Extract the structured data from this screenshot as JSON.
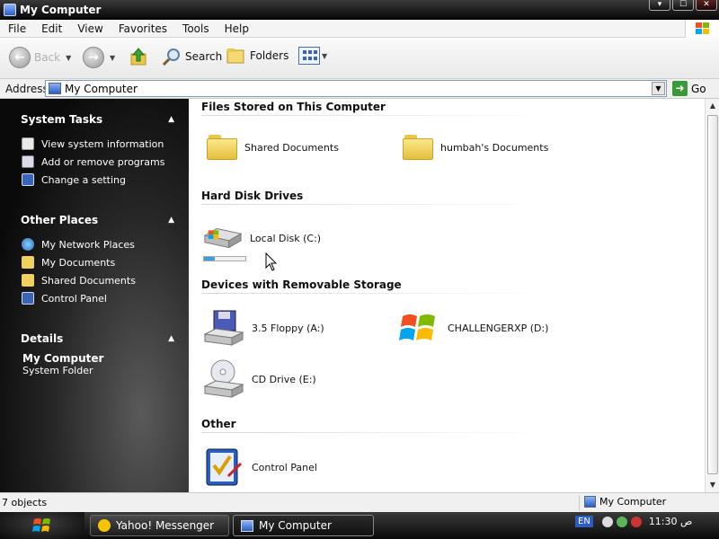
{
  "window": {
    "title": "My Computer",
    "controls": [
      "▾",
      "☐",
      "✕"
    ]
  },
  "menu": [
    "File",
    "Edit",
    "View",
    "Favorites",
    "Tools",
    "Help"
  ],
  "toolbar": {
    "back": "Back",
    "search": "Search",
    "folders": "Folders"
  },
  "address": {
    "label": "Address",
    "value": "My Computer",
    "go": "Go"
  },
  "sidebar": {
    "system_tasks": {
      "title": "System Tasks",
      "items": [
        {
          "label": "View system information",
          "icon": "system-info-icon"
        },
        {
          "label": "Add or remove programs",
          "icon": "add-remove-icon"
        },
        {
          "label": "Change a setting",
          "icon": "control-panel-icon"
        }
      ]
    },
    "other_places": {
      "title": "Other Places",
      "items": [
        {
          "label": "My Network Places",
          "icon": "network-icon"
        },
        {
          "label": "My Documents",
          "icon": "folder-icon"
        },
        {
          "label": "Shared Documents",
          "icon": "folder-icon"
        },
        {
          "label": "Control Panel",
          "icon": "control-panel-icon"
        }
      ]
    },
    "details": {
      "title": "Details",
      "name": "My Computer",
      "type": "System Folder"
    }
  },
  "content": {
    "groups": {
      "files": "Files Stored on This Computer",
      "hdd": "Hard Disk Drives",
      "removable": "Devices with Removable Storage",
      "other": "Other"
    },
    "items": {
      "shared_docs": "Shared Documents",
      "user_docs": "humbah's Documents",
      "local_disk": "Local Disk (C:)",
      "floppy": "3.5 Floppy (A:)",
      "challenger": "CHALLENGERXP (D:)",
      "cd": "CD Drive (E:)",
      "control_panel": "Control Panel"
    },
    "local_disk_used_fraction": 0.25
  },
  "status": {
    "count": "7 objects",
    "location": "My Computer"
  },
  "taskbar": {
    "tasks": [
      "Yahoo! Messenger",
      "My Computer"
    ],
    "language": "EN",
    "clock": "11:30 ص"
  }
}
